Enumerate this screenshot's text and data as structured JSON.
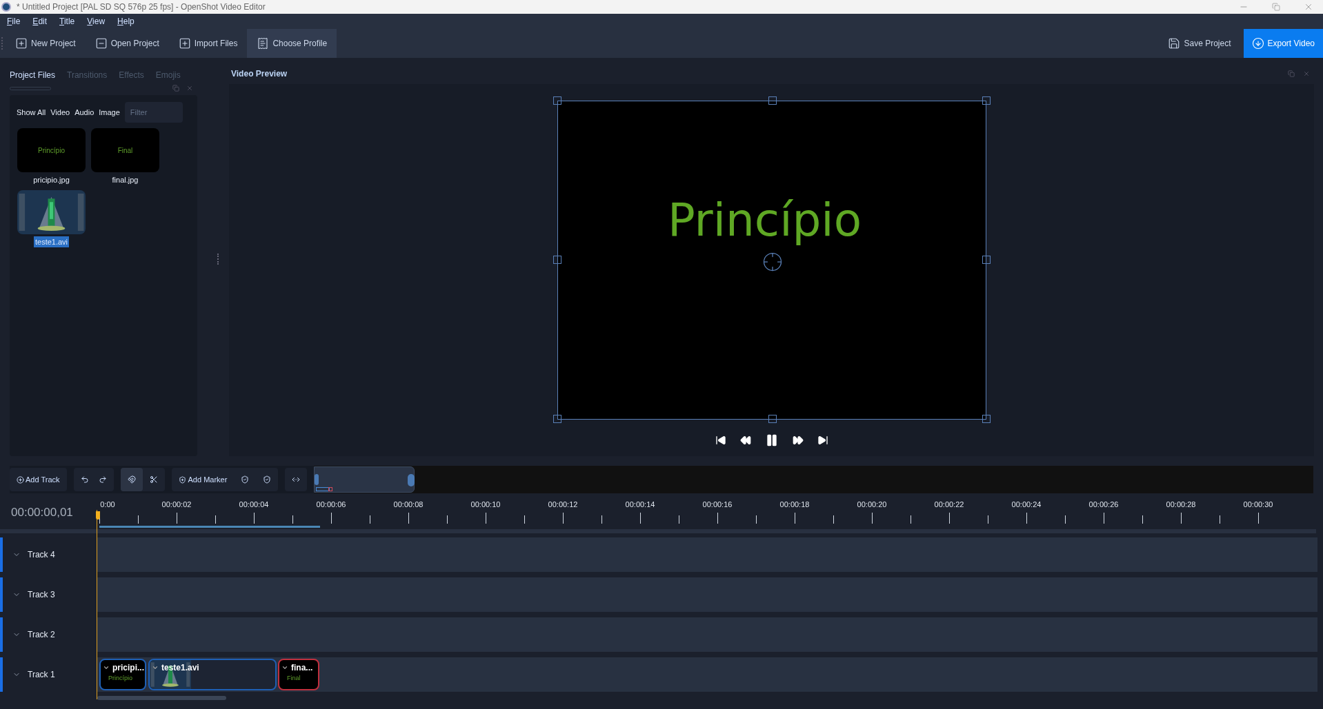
{
  "window": {
    "title": "* Untitled Project [PAL SD SQ 576p 25 fps] - OpenShot Video Editor"
  },
  "menu": [
    "File",
    "Edit",
    "Title",
    "View",
    "Help"
  ],
  "toolbar": {
    "left": [
      {
        "label": "New Project",
        "selected": false
      },
      {
        "label": "Open Project",
        "selected": false
      },
      {
        "label": "Import Files",
        "selected": false
      },
      {
        "label": "Choose Profile",
        "selected": true
      }
    ],
    "right": [
      {
        "label": "Save Project",
        "primary": false
      },
      {
        "label": "Export Video",
        "primary": true
      }
    ]
  },
  "project_files": {
    "tabs": [
      {
        "label": "Project Files",
        "selected": true
      },
      {
        "label": "Transitions",
        "selected": false
      },
      {
        "label": "Effects",
        "selected": false
      },
      {
        "label": "Emojis",
        "selected": false
      }
    ],
    "filters": [
      "Show All",
      "Video",
      "Audio",
      "Image"
    ],
    "filter_placeholder": "Filter",
    "files": [
      {
        "name": "pricipio.jpg",
        "thumb_text": "Princípio",
        "selected": false
      },
      {
        "name": "final.jpg",
        "thumb_text": "Final",
        "selected": false
      },
      {
        "name": "teste1.avi",
        "kind": "video",
        "selected": true
      }
    ]
  },
  "preview": {
    "title": "Video Preview",
    "frame_text": "Princípio",
    "playing": true
  },
  "timeline": {
    "add_track": "Add Track",
    "add_marker": "Add Marker",
    "snapping": true,
    "time": "00:00:00,01",
    "ruler": [
      "0:00",
      "00:00:02",
      "00:00:04",
      "00:00:06",
      "00:00:08",
      "00:00:10",
      "00:00:12",
      "00:00:14",
      "00:00:16",
      "00:00:18",
      "00:00:20",
      "00:00:22",
      "00:00:24",
      "00:00:26",
      "00:00:28",
      "00:00:30"
    ],
    "tracks": [
      {
        "name": "Track 4"
      },
      {
        "name": "Track 3"
      },
      {
        "name": "Track 2"
      },
      {
        "name": "Track 1",
        "clips": [
          {
            "title": "pricipi...",
            "thumb_text": "Princípio",
            "selected": false
          },
          {
            "title": "teste1.avi",
            "kind": "video",
            "selected": false
          },
          {
            "title": "fina...",
            "thumb_text": "Final",
            "selected": true
          }
        ]
      }
    ]
  }
}
